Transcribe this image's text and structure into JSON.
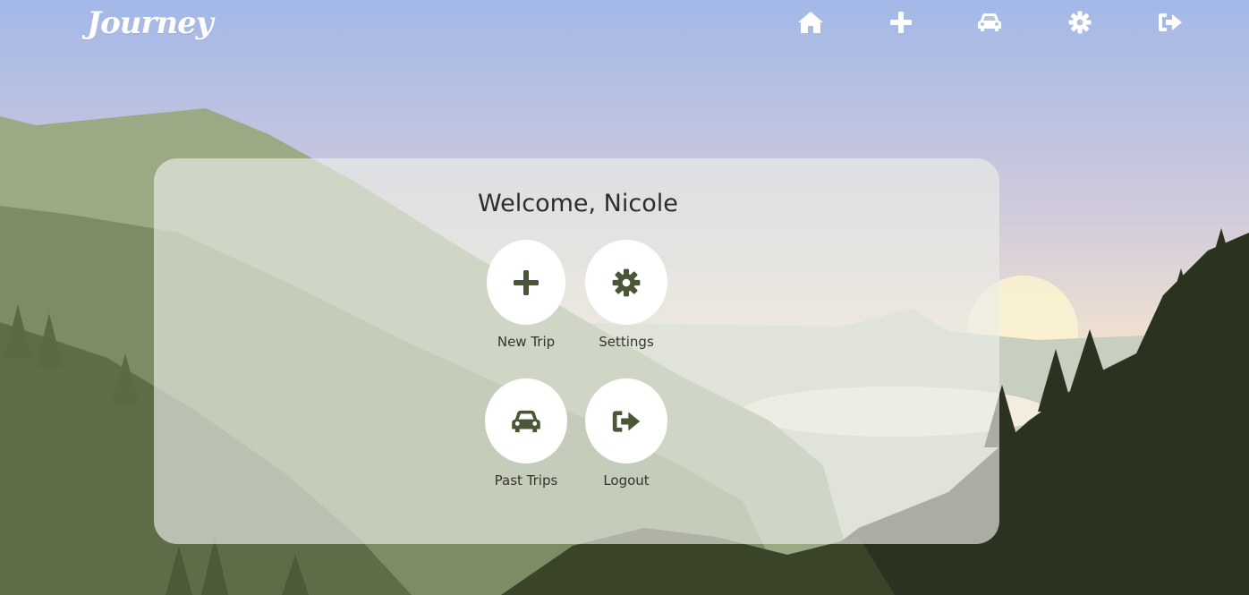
{
  "brand": {
    "logo_text": "Journey"
  },
  "topnav": {
    "items": [
      {
        "icon": "home-icon",
        "color": "#ffffff"
      },
      {
        "icon": "plus-icon",
        "color": "#ffffff"
      },
      {
        "icon": "car-icon",
        "color": "#ffffff"
      },
      {
        "icon": "gear-icon",
        "color": "#ffffff"
      },
      {
        "icon": "logout-icon",
        "color": "#ffffff"
      }
    ]
  },
  "welcome": {
    "text": "Welcome, Nicole"
  },
  "actions": [
    {
      "label": "New Trip",
      "icon": "plus-icon"
    },
    {
      "label": "Settings",
      "icon": "gear-icon"
    },
    {
      "label": "Past Trips",
      "icon": "car-icon"
    },
    {
      "label": "Logout",
      "icon": "logout-icon"
    }
  ],
  "colors": {
    "icon_dark": "#4a5637",
    "sky_top": "#a3b8e8",
    "sky_bottom": "#f5e2c5",
    "forest_dark": "#2b3320"
  }
}
